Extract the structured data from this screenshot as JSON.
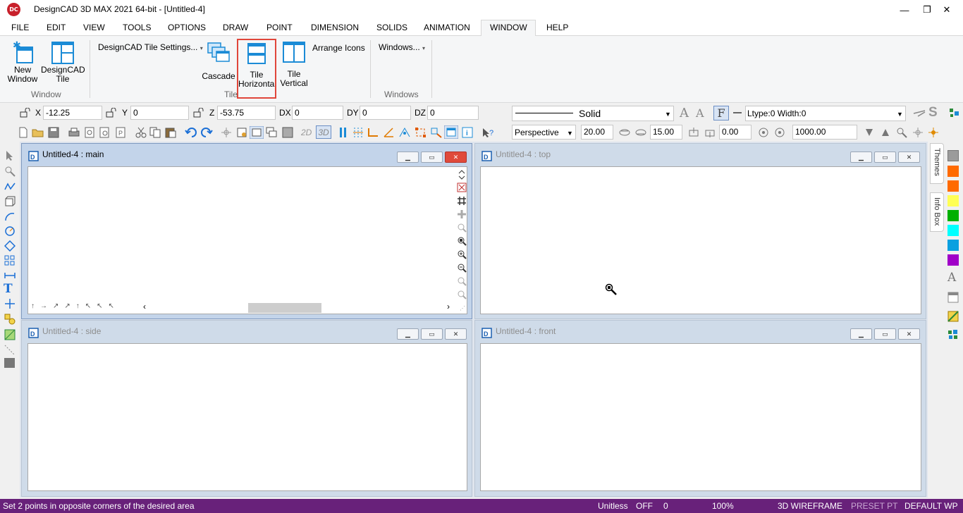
{
  "window": {
    "title": "DesignCAD 3D MAX 2021 64-bit - [Untitled-4]",
    "logo_text": "DC",
    "minimize": "—",
    "restore": "❐",
    "close": "✕"
  },
  "menu": [
    "FILE",
    "EDIT",
    "VIEW",
    "TOOLS",
    "OPTIONS",
    "DRAW",
    "POINT",
    "DIMENSION",
    "SOLIDS",
    "ANIMATION",
    "WINDOW",
    "HELP"
  ],
  "ribbon": {
    "new_window": {
      "line1": "New",
      "line2": "Window"
    },
    "designcad_tile": {
      "line1": "DesignCAD",
      "line2": "Tile"
    },
    "group_window": "Window",
    "tile_settings": "DesignCAD Tile Settings...",
    "cascade": "Cascade",
    "tile_horizontal": {
      "line1": "Tile",
      "line2": "Horizontal"
    },
    "tile_vertical": {
      "line1": "Tile",
      "line2": "Vertical"
    },
    "arrange_icons": "Arrange Icons",
    "group_tile": "Tile",
    "windows_dropdown": "Windows...",
    "group_windows": "Windows"
  },
  "coords": {
    "x_label": "X",
    "x_value": "-12.25",
    "y_label": "Y",
    "y_value": "0",
    "z_label": "Z",
    "z_value": "-53.75",
    "dx_label": "DX",
    "dx_value": "0",
    "dy_label": "DY",
    "dy_value": "0",
    "dz_label": "DZ",
    "dz_value": "0"
  },
  "line_style": {
    "value": "Solid",
    "ltype": "Ltype:0  Width:0"
  },
  "view": {
    "projection": "Perspective",
    "mode_2d": "2D",
    "mode_3d": "3D",
    "field1": "20.00",
    "field2": "15.00",
    "field3": "0.00",
    "field4": "1000.00"
  },
  "windows": [
    {
      "title": "Untitled-4 : main",
      "active": true
    },
    {
      "title": "Untitled-4 : top",
      "active": false
    },
    {
      "title": "Untitled-4 : side",
      "active": false
    },
    {
      "title": "Untitled-4 : front",
      "active": false
    }
  ],
  "side_tabs": {
    "themes": "Themes",
    "info_box": "Info Box"
  },
  "colors": {
    "statusbar": "#68217a",
    "highlight": "#e0463a",
    "swatches": [
      "#9b9b9b",
      "#ff6a00",
      "#ff6a00",
      "#ffff55",
      "#00b000",
      "#00ffff",
      "#0aa0e0",
      "#a000c8"
    ]
  },
  "status": {
    "message": "Set 2 points in opposite corners of the desired area",
    "units": "Unitless",
    "snap": "OFF",
    "count": "0",
    "zoom": "100%",
    "render_mode": "3D WIREFRAME",
    "preset": "PRESET PT",
    "workplane": "DEFAULT WP"
  }
}
